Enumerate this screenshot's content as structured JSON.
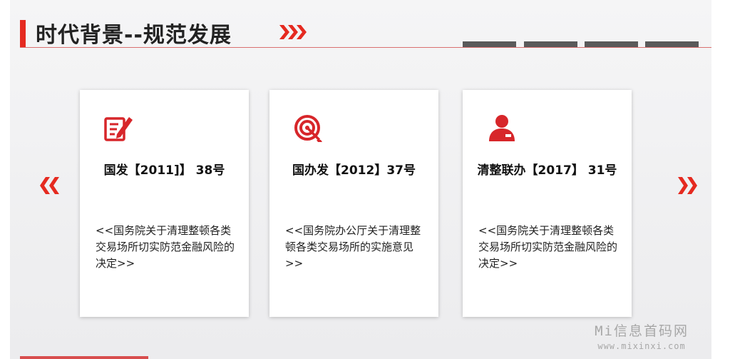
{
  "header": {
    "title": "时代背景--规范发展",
    "accent_color": "#e52a20",
    "tabs_count": 4
  },
  "cards": [
    {
      "icon": "document-edit-icon",
      "heading": "国发【2011]】 38号",
      "body": "<<国务院关于清理整顿各类交易场所切实防范金融风险的决定>>"
    },
    {
      "icon": "target-icon",
      "heading": "国办发【2012】37号",
      "body": "<<国务院办公厅关于清理整顿各类交易场所的实施意见>>"
    },
    {
      "icon": "user-icon",
      "heading": "清整联办【2017】 31号",
      "body": "<<国务院关于清理整顿各类交易场所切实防范金融风险的决定>>"
    }
  ],
  "navigation": {
    "prev_icon": "chevrons-left-icon",
    "next_icon": "chevrons-right-icon"
  },
  "watermark": {
    "main": "Mi信息首码网",
    "sub": "www.mixinxi.com"
  }
}
